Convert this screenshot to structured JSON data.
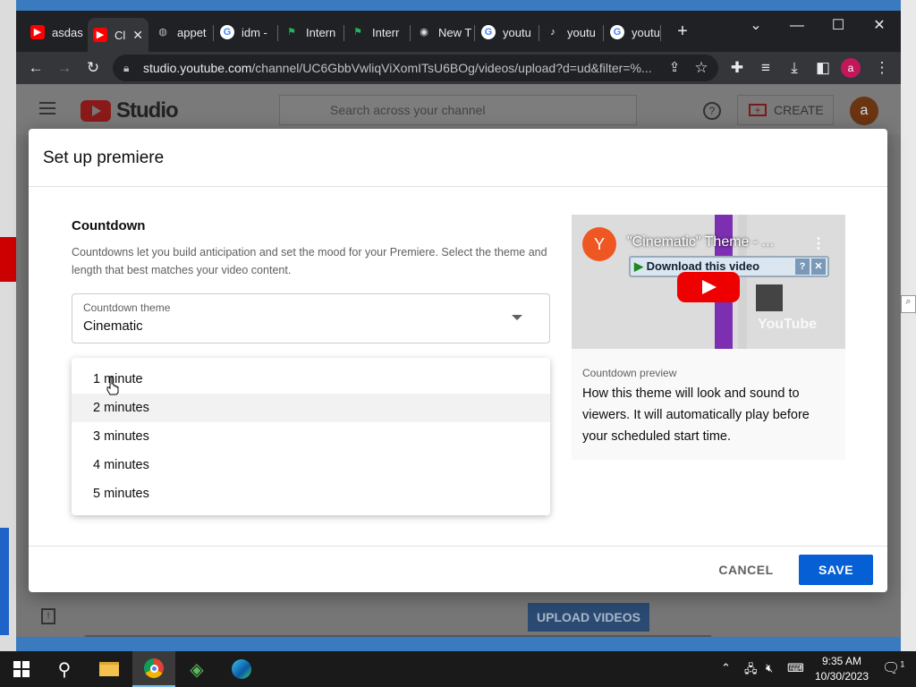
{
  "browser": {
    "tabs": [
      {
        "label": "asdas",
        "icon": "youtube-icon",
        "active": false
      },
      {
        "label": "Cl",
        "icon": "youtube-icon",
        "active": true
      },
      {
        "label": "appet",
        "icon": "globe-icon",
        "active": false
      },
      {
        "label": "idm -",
        "icon": "google-icon",
        "active": false
      },
      {
        "label": "Intern",
        "icon": "green-flag-icon",
        "active": false
      },
      {
        "label": "Interr",
        "icon": "green-flag-icon",
        "active": false
      },
      {
        "label": "New T",
        "icon": "chrome-icon",
        "active": false
      },
      {
        "label": "youtu",
        "icon": "google-icon",
        "active": false
      },
      {
        "label": "youtu",
        "icon": "tiktok-icon",
        "active": false
      },
      {
        "label": "youtu",
        "icon": "google-icon",
        "active": false
      }
    ],
    "url_host": "studio.youtube.com",
    "url_path": "/channel/UC6GbbVwliqViXomITsU6BOg/videos/upload?d=ud&filter=%...",
    "profile_initial": "a"
  },
  "studio": {
    "logo_text": "Studio",
    "search_placeholder": "Search across your channel",
    "create_label": "CREATE",
    "avatar_initial": "a",
    "upload_label": "UPLOAD VIDEOS"
  },
  "dialog": {
    "title": "Set up premiere",
    "section_title": "Countdown",
    "section_desc": "Countdowns let you build anticipation and set the mood for your Premiere. Select the theme and length that best matches your video content.",
    "theme_label": "Countdown theme",
    "theme_value": "Cinematic",
    "length_options": [
      "1 minute",
      "2 minutes",
      "3 minutes",
      "4 minutes",
      "5 minutes"
    ],
    "preview": {
      "channel_initial": "Y",
      "video_title": "\"Cinematic\" Theme - ...",
      "download_banner": "Download this video",
      "watermark": "YouTube",
      "label": "Countdown preview",
      "description": "How this theme will look and sound to viewers. It will automatically play before your scheduled start time."
    },
    "cancel_label": "CANCEL",
    "save_label": "SAVE"
  },
  "taskbar": {
    "time": "9:35 AM",
    "date": "10/30/2023",
    "notification_count": "1"
  }
}
